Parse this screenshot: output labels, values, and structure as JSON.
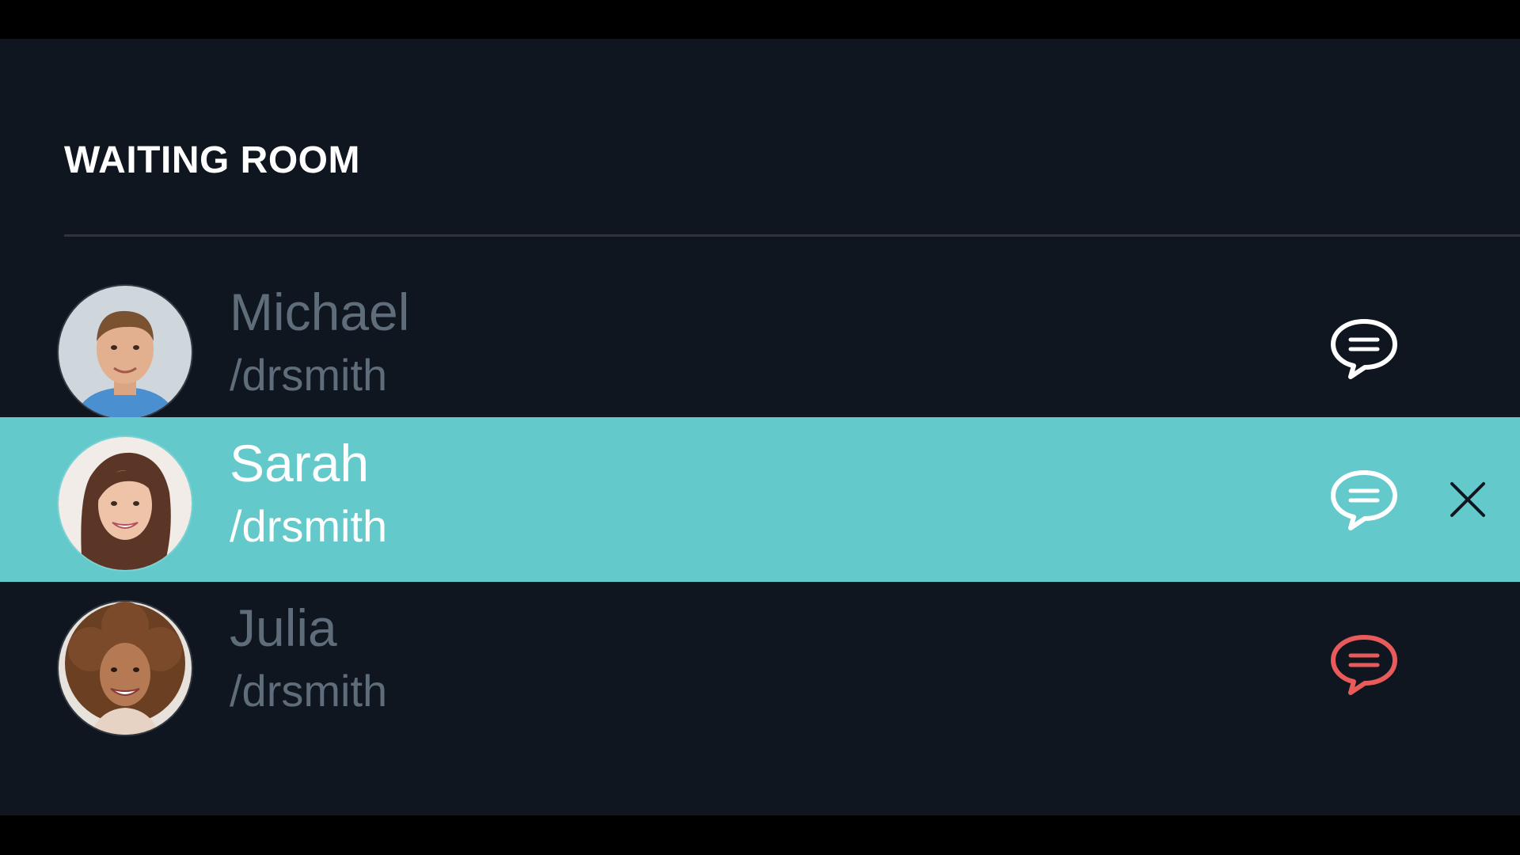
{
  "panel": {
    "title": "WAITING ROOM"
  },
  "colors": {
    "background": "#0f1620",
    "highlight": "#63c9cb",
    "muted_text": "#5f6d7b",
    "chat_default": "#ffffff",
    "chat_alert": "#e95b5b"
  },
  "patients": [
    {
      "name": "Michael",
      "handle": "/drsmith",
      "selected": false,
      "chat_icon": "chat-bubble-icon",
      "chat_color": "#ffffff"
    },
    {
      "name": "Sarah",
      "handle": "/drsmith",
      "selected": true,
      "chat_icon": "chat-bubble-icon",
      "chat_color": "#ffffff",
      "close_icon": "close-icon"
    },
    {
      "name": "Julia",
      "handle": "/drsmith",
      "selected": false,
      "chat_icon": "chat-bubble-icon",
      "chat_color": "#e95b5b"
    }
  ]
}
